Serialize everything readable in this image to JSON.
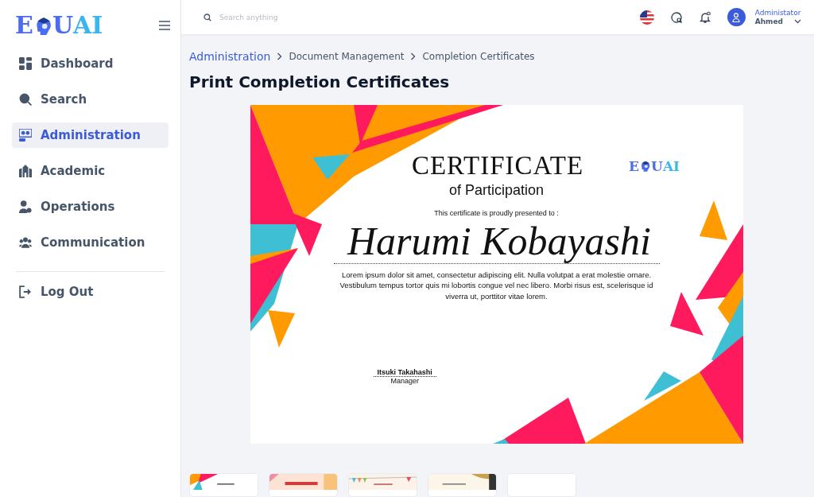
{
  "logo": {
    "parts": [
      "E",
      "U",
      "AI"
    ]
  },
  "sidebar": {
    "items": [
      {
        "label": "Dashboard",
        "selected": false
      },
      {
        "label": "Search",
        "selected": false
      },
      {
        "label": "Administration",
        "selected": true
      },
      {
        "label": "Academic",
        "selected": false
      },
      {
        "label": "Operations",
        "selected": false
      },
      {
        "label": "Communication",
        "selected": false
      }
    ],
    "logout": {
      "label": "Log Out"
    }
  },
  "header": {
    "search": {
      "placeholder": "Search anything"
    },
    "user": {
      "role": "Administator",
      "name": "Ahmed"
    }
  },
  "breadcrumb": [
    {
      "label": "Administration",
      "kind": "link"
    },
    {
      "label": "Document Management",
      "kind": "text"
    },
    {
      "label": "Completion Certificates",
      "kind": "text"
    }
  ],
  "page_title": "Print Completion Certificates",
  "certificate": {
    "title": "CERTIFICATE",
    "subtitle": "of Participation",
    "logo_parts": [
      "E",
      "U",
      "AI"
    ],
    "intro": "This certificate is proudly presented to :",
    "recipient": "Harumi Kobayashi",
    "body": "Lorem ipsum dolor sit amet, consectetur adipiscing elit. Nulla volutpat a erat molestie ornare. Vestibulum tempus tortor quis mi lobortis congue vel nec libero. Morbi risus est, scelerisque id viverra ut, porttitor vitae lorem.",
    "signer": "Itsuki Takahashi",
    "signer_role": "Manager"
  },
  "templates": [
    {
      "kind": "triangles"
    },
    {
      "kind": "ribbon"
    },
    {
      "kind": "bunting"
    },
    {
      "kind": "gold"
    },
    {
      "kind": "blank"
    }
  ]
}
